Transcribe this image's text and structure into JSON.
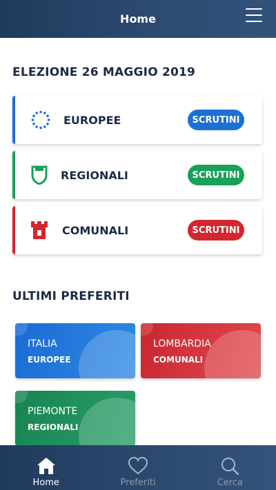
{
  "header": {
    "title": "Home"
  },
  "election": {
    "title": "ELEZIONE 26 MAGGIO 2019",
    "items": [
      {
        "label": "EUROPEE",
        "button": "SCRUTINI",
        "icon": "eu-stars-icon",
        "color": "#1c6fd3"
      },
      {
        "label": "REGIONALI",
        "button": "SCRUTINI",
        "icon": "region-shield-icon",
        "color": "#19a05a"
      },
      {
        "label": "COMUNALI",
        "button": "SCRUTINI",
        "icon": "city-tower-icon",
        "color": "#d3262f"
      }
    ]
  },
  "favorites": {
    "title": "ULTIMI PREFERITI",
    "items": [
      {
        "region": "ITALIA",
        "type": "EUROPEE",
        "color": "#1e73d9"
      },
      {
        "region": "LOMBARDIA",
        "type": "COMUNALI",
        "color": "#d1313a"
      },
      {
        "region": "PIEMONTE",
        "type": "REGIONALI",
        "color": "#1c8d57"
      }
    ]
  },
  "nav": {
    "items": [
      {
        "label": "Home",
        "icon": "home-icon"
      },
      {
        "label": "Preferiti",
        "icon": "heart-icon"
      },
      {
        "label": "Cerca",
        "icon": "search-icon"
      }
    ]
  }
}
